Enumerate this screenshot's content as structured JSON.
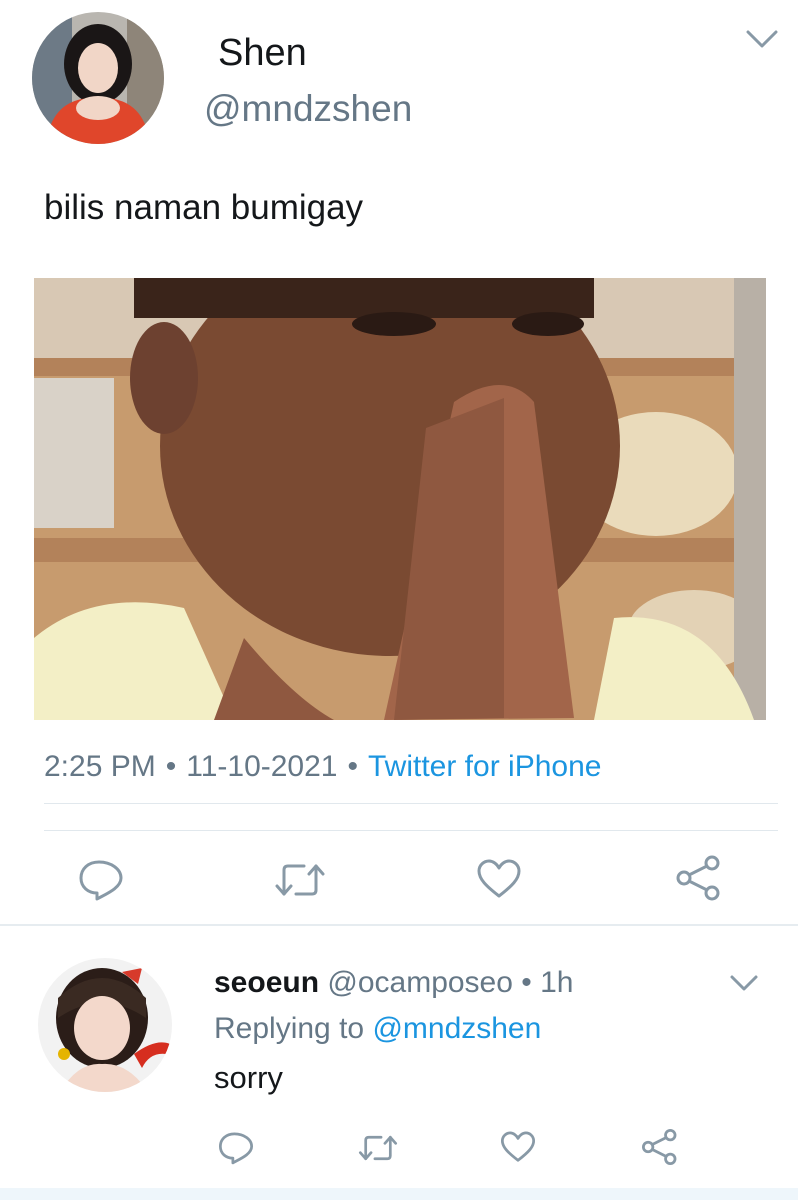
{
  "tweet": {
    "display_name": "Shen",
    "handle": "@mndzshen",
    "text": "bilis naman bumigay",
    "time": "2:25 PM",
    "date": "11-10-2021",
    "client": "Twitter for iPhone",
    "media_description": "GIF"
  },
  "actions": {
    "reply_icon": "speech-bubble",
    "retweet_icon": "retweet-arrows",
    "like_icon": "heart",
    "share_icon": "share-nodes"
  },
  "reply": {
    "display_name": "seoeun",
    "handle": "@ocamposeo",
    "age": "1h",
    "replying_prefix": "Replying to",
    "replying_to": "@mndzshen",
    "text": "sorry"
  },
  "colors": {
    "link": "#1b95e0",
    "secondary_text": "#657786",
    "primary_text": "#14171a",
    "divider": "#e1e8ed"
  }
}
